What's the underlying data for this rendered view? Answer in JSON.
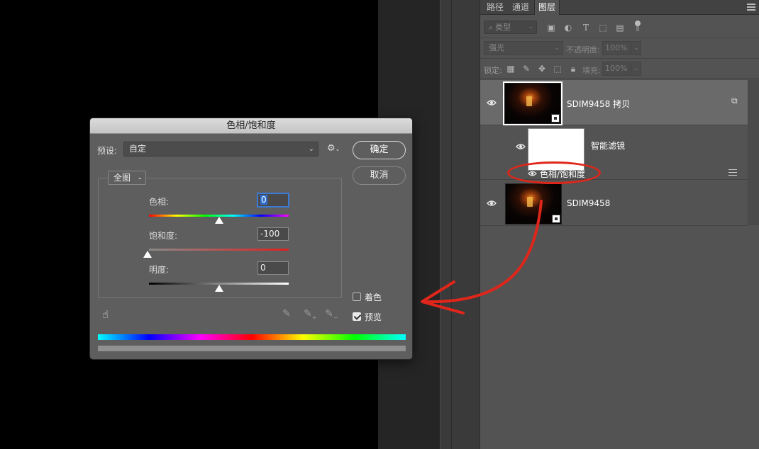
{
  "panel": {
    "tabs": [
      {
        "label": "路径"
      },
      {
        "label": "通道"
      },
      {
        "label": "图层"
      }
    ],
    "filter_kind": "类型",
    "blend_mode": "强光",
    "opacity_label": "不透明度:",
    "opacity_value": "100%",
    "lock_label": "锁定:",
    "fill_label": "填充:",
    "fill_value": "100%"
  },
  "layers": [
    {
      "name": "SDIM9458 拷贝",
      "selected": true,
      "smart_object": true
    },
    {
      "name": "智能滤镜",
      "type": "smart-filter-mask"
    },
    {
      "name": "色相/饱和度",
      "type": "smart-filter"
    },
    {
      "name": "SDIM9458",
      "selected": false,
      "smart_object": true
    }
  ],
  "dialog": {
    "title": "色相/饱和度",
    "preset_label": "预设:",
    "preset_value": "自定",
    "ok_label": "确定",
    "cancel_label": "取消",
    "channel": "全图",
    "hue": {
      "label": "色相:",
      "value": "0",
      "level": 0.5
    },
    "saturation": {
      "label": "饱和度:",
      "value": "-100",
      "level": 0.0
    },
    "lightness": {
      "label": "明度:",
      "value": "0",
      "level": 0.5
    },
    "colorize": {
      "label": "着色",
      "checked": false
    },
    "preview": {
      "label": "预览",
      "checked": true
    }
  },
  "annotation_color": "#e0261a"
}
